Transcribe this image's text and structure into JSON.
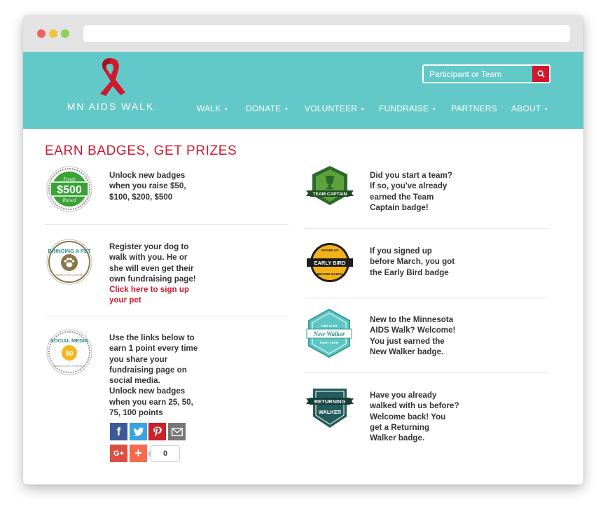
{
  "site": {
    "logo_text": "MN AIDS WALK",
    "search_placeholder": "Participant or Team"
  },
  "nav": [
    "WALK",
    "DONATE",
    "VOLUNTEER",
    "FUNDRAISE",
    "PARTNERS",
    "ABOUT"
  ],
  "colors": {
    "brand_teal": "#63c9c8",
    "brand_red": "#d1192e"
  },
  "page_title": "EARN BADGES, GET PRIZES",
  "badges": {
    "raise": {
      "badge_top": "Funds",
      "badge_amount": "$500",
      "badge_bottom": "Raised",
      "lines": [
        "Unlock new badges",
        "when you raise $50,",
        "$100, $200, $500"
      ]
    },
    "pet": {
      "badge_top": "BRINGING A PET",
      "badge_bottom": "PAWS FOR A CAUSE",
      "lines": [
        "Register your dog to",
        "walk with you. He or",
        "she will even get their",
        "own fundraising page!"
      ],
      "link_lines": [
        "Click here to sign up",
        "your pet"
      ]
    },
    "social": {
      "badge_top": "SOCIAL MEDIA",
      "badge_amount": "50",
      "badge_bottom": "SHARE WITH FRIENDS",
      "lines": [
        "Use the links below to",
        "earn 1 point every time",
        "you share your",
        "fundraising page on",
        "social media.",
        "Unlock new badges",
        "when you earn 25, 50,",
        "75, 100 points"
      ]
    },
    "team_captain": {
      "badge_text": "TEAM CAPTAIN",
      "lines": [
        "Did you start a team?",
        "If so, you've already",
        "earned the Team",
        "Captain badge!"
      ]
    },
    "early_bird": {
      "badge_top": "SIGNED UP",
      "badge_text": "EARLY BIRD",
      "badge_bottom": "BEFORE MARCH",
      "lines": [
        "If you signed up",
        "before March, you got",
        "the Early Bird badge"
      ]
    },
    "new_walker": {
      "badge_top": "THIS IS MY",
      "badge_text": "New Walker",
      "badge_bottom": "FIRST YEAR",
      "lines": [
        "New to the Minnesota",
        "AIDS Walk? Welcome!",
        "You just earned the",
        "New Walker badge."
      ]
    },
    "returning": {
      "badge_top": "RETURNING",
      "badge_bottom": "WALKER",
      "lines": [
        "Have you already",
        "walked with us before?",
        "Welcome back! You",
        "get a Returning",
        "Walker badge."
      ]
    }
  },
  "share": {
    "facebook": "f",
    "googleplus": "G+",
    "addthis": "+",
    "count": "0"
  }
}
